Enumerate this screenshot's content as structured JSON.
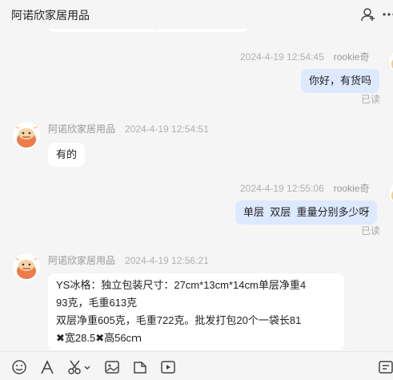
{
  "header": {
    "title": "阿诺欣家居用品",
    "icons": [
      "add-contact-icon",
      "more-icon"
    ]
  },
  "messages": [
    {
      "sender": "me",
      "time": "2024-4-19 12:54:45",
      "name": "rookie奇",
      "text": "你好，有货吗",
      "status": "已读"
    },
    {
      "sender": "shop",
      "name": "阿诺欣家居用品",
      "time": "2024-4-19 12:54:51",
      "text": "有的"
    },
    {
      "sender": "me",
      "time": "2024-4-19 12:55:06",
      "name": "rookie奇",
      "text": "单层  双层  重量分别多少呀",
      "status": "已读"
    },
    {
      "sender": "shop",
      "name": "阿诺欣家居用品",
      "time": "2024-4-19 12:56:21",
      "lines": [
        "YS冰格：独立包装尺寸：27cm*13cm*14cm单层净重4",
        "93克，毛重613克",
        "双层净重605克，毛重722克。批发打包20个一袋长81",
        "✖宽28.5✖高56cｍ"
      ]
    }
  ],
  "toolbar": {
    "icons": [
      "emoji-icon",
      "font-icon",
      "scissors-icon",
      "image-icon",
      "folder-icon",
      "video-icon",
      "more-tools-icon"
    ]
  },
  "colors": {
    "background": "#f5f5f5",
    "my_bubble": "#dde9ff",
    "their_bubble": "#ffffff",
    "avatar_orange": "#f07a4a"
  }
}
